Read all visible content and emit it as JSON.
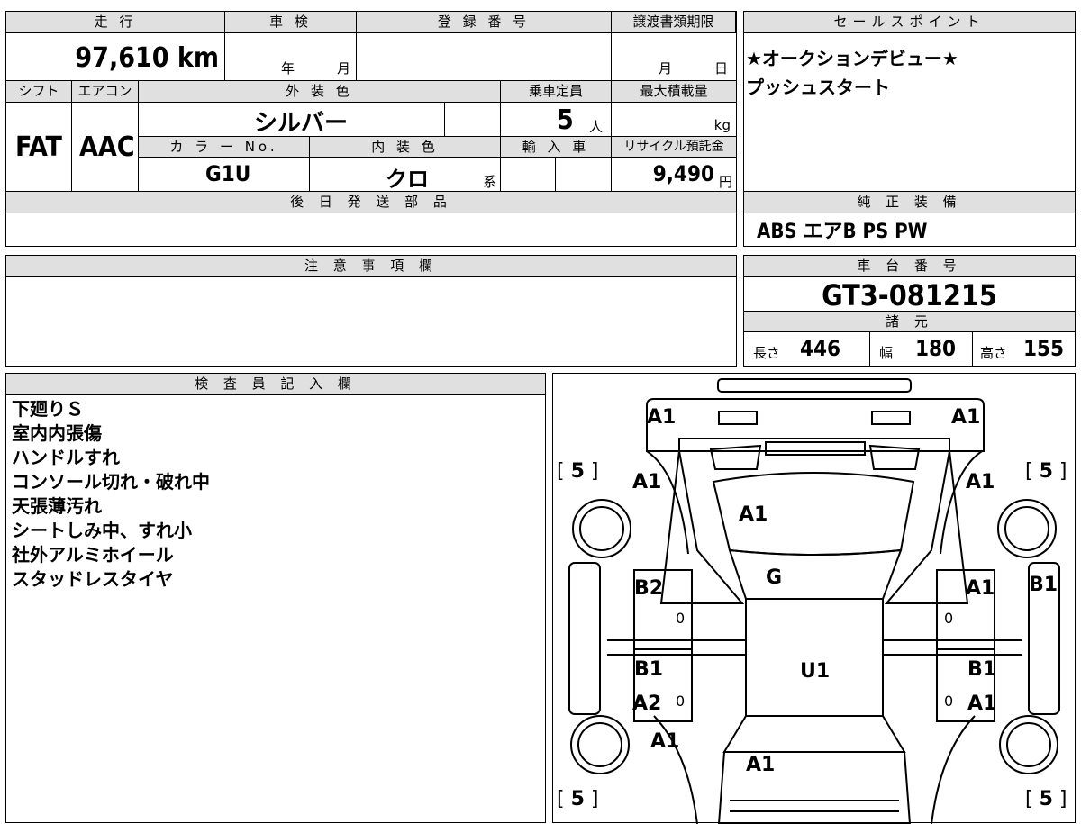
{
  "top": {
    "mileage_label": "走 行",
    "mileage_value": "97,610 km",
    "shaken_label": "車 検",
    "shaken_year": "年",
    "shaken_month": "月",
    "reg_label": "登 録 番 号",
    "transfer_label": "譲渡書類期限",
    "transfer_month": "月",
    "transfer_day": "日"
  },
  "row2": {
    "shift_label": "シフト",
    "ac_label": "エアコン",
    "ext_color_label": "外 装 色",
    "capacity_label": "乗車定員",
    "maxload_label": "最大積載量",
    "shift_value": "FAT",
    "ac_value": "AAC",
    "ext_color_value": "シルバー",
    "capacity_value": "5",
    "capacity_unit": "人",
    "maxload_unit": "kg",
    "colorno_label": "カ ラ ー No.",
    "int_color_label": "内 装 色",
    "import_label": "輸 入 車",
    "recycle_label": "リサイクル預託金",
    "colorno_value": "G1U",
    "int_color_value": "クロ",
    "int_color_suffix": "系",
    "recycle_value": "9,490",
    "recycle_unit": "円"
  },
  "later_parts_label": "後 日 発 送 部 品",
  "sales": {
    "label": "セールスポイント",
    "lines": [
      "★オークションデビュー★",
      "プッシュスタート"
    ]
  },
  "equip": {
    "label": "純 正 装 備",
    "value": "ABS エアB PS PW"
  },
  "caution_label": "注 意 事 項 欄",
  "chassis": {
    "label": "車 台 番 号",
    "value": "GT3-081215",
    "spec_label": "諸 元",
    "len_label": "長さ",
    "len_value": "446",
    "wid_label": "幅",
    "wid_value": "180",
    "hgt_label": "高さ",
    "hgt_value": "155"
  },
  "inspector": {
    "label": "検 査 員 記 入 欄",
    "notes": [
      "下廻りＳ",
      "室内内張傷",
      "ハンドルすれ",
      "コンソール切れ・破れ中",
      "天張薄汚れ",
      "シートしみ中、すれ小",
      "社外アルミホイール",
      "スタッドレスタイヤ"
    ]
  },
  "diagram": {
    "codes": {
      "rear_left": "A1",
      "rear_right": "A1",
      "fl_fender": "A1",
      "fr_fender": "A1",
      "hood": "A1",
      "windshield": "G",
      "front_left_door": "B2",
      "front_right_door": "A1",
      "right_side": "B1",
      "roof": "U1",
      "rear_left_door_1": "B1",
      "rear_left_door_2": "A2",
      "rear_right_door_1": "B1",
      "rear_right_door_2": "A1",
      "rl_fender": "A1",
      "trunk": "A1"
    },
    "tire_tl": "5",
    "tire_tr": "5",
    "tire_bl": "5",
    "tire_br": "5",
    "zero": "0"
  }
}
